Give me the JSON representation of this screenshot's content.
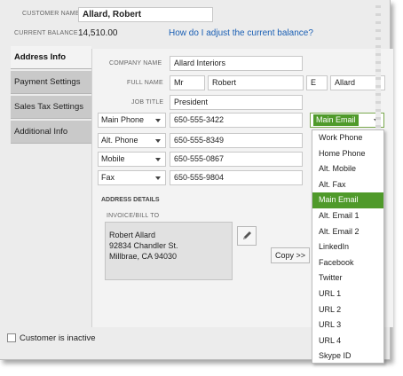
{
  "header": {
    "customer_name_label": "CUSTOMER NAME",
    "customer_name": "Allard, Robert",
    "balance_label": "CURRENT BALANCE",
    "balance_value": "14,510.00",
    "balance_help_link": "How do I adjust the current balance?",
    "link_color": "#1a5fb4"
  },
  "tabs": [
    {
      "label": "Address Info",
      "active": true
    },
    {
      "label": "Payment Settings",
      "active": false
    },
    {
      "label": "Sales Tax Settings",
      "active": false
    },
    {
      "label": "Additional Info",
      "active": false
    }
  ],
  "form": {
    "company_name_label": "COMPANY NAME",
    "company_name": "Allard Interiors",
    "full_name_label": "FULL NAME",
    "salutation": "Mr",
    "first_name": "Robert",
    "middle_initial": "E",
    "last_name": "Allard",
    "job_title_label": "JOB TITLE",
    "job_title": "President"
  },
  "contacts": [
    {
      "type": "Main Phone",
      "value": "650-555-3422"
    },
    {
      "type": "Alt. Phone",
      "value": "650-555-8349"
    },
    {
      "type": "Mobile",
      "value": "650-555-0867"
    },
    {
      "type": "Fax",
      "value": "650-555-9804"
    }
  ],
  "email_combo": {
    "selected": "Main Email",
    "accent": "#4f9a2a"
  },
  "address": {
    "section_label": "ADDRESS DETAILS",
    "invoice_label": "INVOICE/BILL TO",
    "line1": "Robert Allard",
    "line2": "92834 Chandler St.",
    "line3": "Millbrae, CA 94030",
    "edit_icon": "pencil-icon",
    "copy_button": "Copy >>"
  },
  "dropdown_options": [
    "Work Phone",
    "Home Phone",
    "Alt. Mobile",
    "Alt. Fax",
    "Main Email",
    "Alt. Email 1",
    "Alt. Email 2",
    "LinkedIn",
    "Facebook",
    "Twitter",
    "URL 1",
    "URL 2",
    "URL 3",
    "URL 4",
    "Skype ID"
  ],
  "dropdown_selected_index": 4,
  "footer": {
    "inactive_label": "Customer is inactive"
  }
}
